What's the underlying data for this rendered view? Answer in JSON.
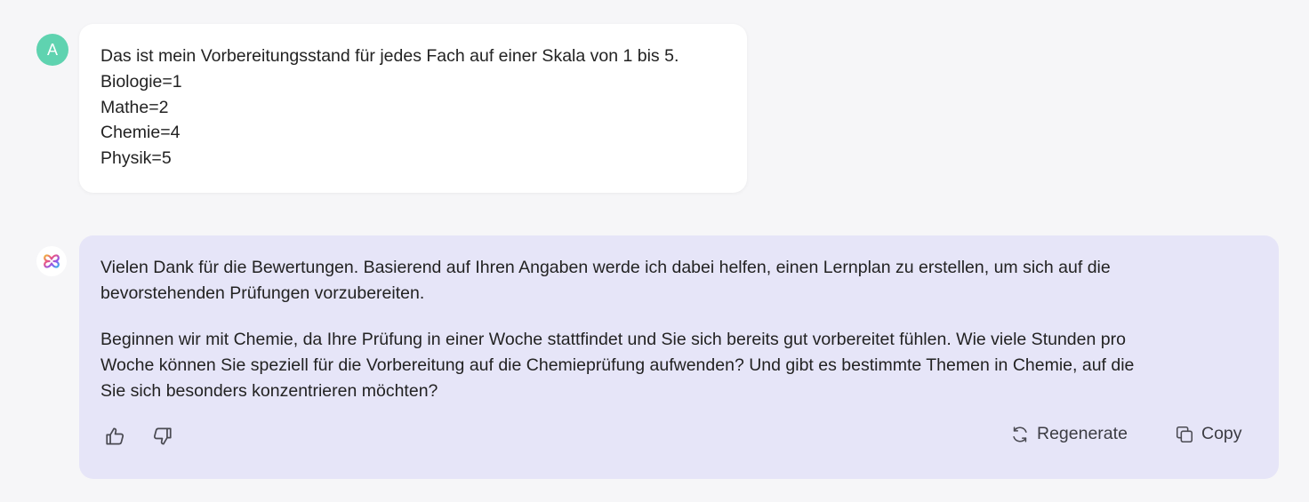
{
  "user_message": {
    "avatar_letter": "A",
    "lines": [
      "Das ist mein Vorbereitungsstand für jedes Fach auf einer Skala von 1 bis 5.",
      "Biologie=1",
      "Mathe=2",
      "Chemie=4",
      "Physik=5"
    ]
  },
  "assistant_message": {
    "paragraph1_line1": "Vielen Dank für die Bewertungen. Basierend auf Ihren Angaben werde ich dabei helfen, einen Lernplan zu erstellen, um sich auf die",
    "paragraph1_line2": "bevorstehenden Prüfungen vorzubereiten.",
    "paragraph2_line1": "Beginnen wir mit Chemie, da Ihre Prüfung in einer Woche stattfindet und Sie sich bereits gut vorbereitet fühlen. Wie viele Stunden pro",
    "paragraph2_line2": "Woche können Sie speziell für die Vorbereitung auf die Chemieprüfung aufwenden? Und gibt es bestimmte Themen in Chemie, auf die",
    "paragraph2_line3": "Sie sich besonders konzentrieren möchten?"
  },
  "actions": {
    "thumbs_up_icon": "thumbs-up-icon",
    "thumbs_down_icon": "thumbs-down-icon",
    "regenerate_label": "Regenerate",
    "copy_label": "Copy"
  },
  "colors": {
    "page_background": "#f6f6f8",
    "user_avatar": "#5fd3b0",
    "assistant_bubble": "#e6e5f8",
    "user_bubble": "#ffffff"
  }
}
